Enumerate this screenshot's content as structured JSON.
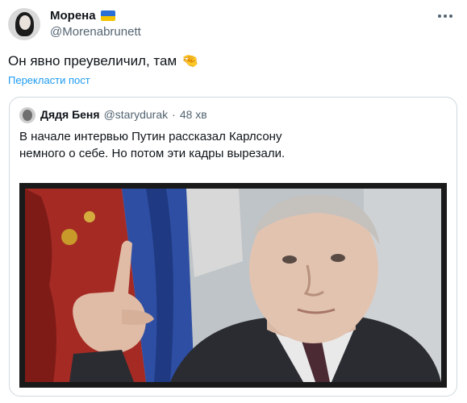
{
  "tweet": {
    "display_name": "Морена",
    "handle": "@Morenabrunett",
    "text": "Он явно преувеличил, там",
    "emoji_icon": "pinching-hand-icon",
    "translate_label": "Перекласти пост",
    "flag_colors": {
      "top": "#2b6fd6",
      "bottom": "#f5c400"
    }
  },
  "quote": {
    "display_name": "Дядя Беня",
    "handle": "@starydurak",
    "separator": "·",
    "time": "48 хв",
    "text_line1": "В начале интервью Путин рассказал Карлсону",
    "text_line2": "немного о себе. Но потом эти кадры вырезали."
  },
  "colors": {
    "link": "#1d9bf0",
    "secondary_text": "#536471",
    "border": "#cfd9de"
  }
}
